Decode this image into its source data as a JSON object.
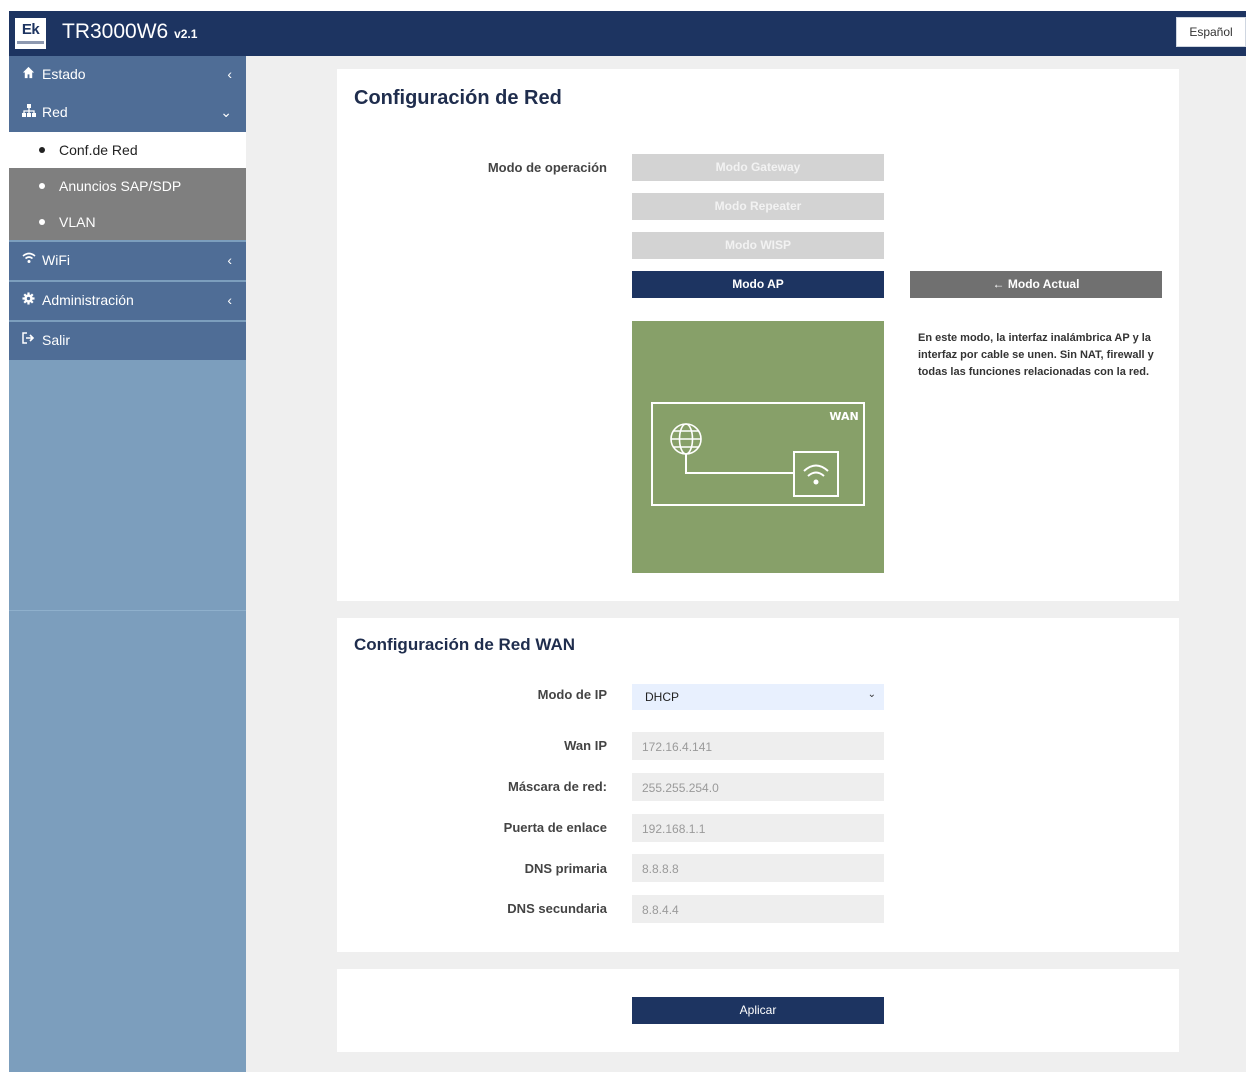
{
  "header": {
    "logo_text": "Ek",
    "title": "TR3000W6",
    "version": "v2.1",
    "language": "Español"
  },
  "sidebar": {
    "items": [
      {
        "icon": "home-icon",
        "label": "Estado",
        "chevron": "‹"
      },
      {
        "icon": "sitemap-icon",
        "label": "Red",
        "chevron": "⌄"
      },
      {
        "icon": "wifi-icon",
        "label": "WiFi",
        "chevron": "‹"
      },
      {
        "icon": "gear-icon",
        "label": "Administración",
        "chevron": "‹"
      },
      {
        "icon": "sign-out-icon",
        "label": "Salir"
      }
    ],
    "subitems": [
      {
        "label": "Conf.de Red",
        "active": true
      },
      {
        "label": "Anuncios SAP/SDP",
        "active": false
      },
      {
        "label": "VLAN",
        "active": false
      }
    ]
  },
  "network_config": {
    "title": "Configuración de Red",
    "operation_mode_label": "Modo de operación",
    "modes": [
      {
        "label": "Modo Gateway",
        "active": false
      },
      {
        "label": "Modo Repeater",
        "active": false
      },
      {
        "label": "Modo WISP",
        "active": false
      },
      {
        "label": "Modo AP",
        "active": true
      }
    ],
    "current_mode_label": "← Modo Actual",
    "diagram_wan_label": "WAN",
    "description": "En este modo, la interfaz inalámbrica AP y la interfaz por cable se unen. Sin NAT, firewall y todas las funciones relacionadas con la red."
  },
  "wan_config": {
    "title": "Configuración de Red WAN",
    "ip_mode": {
      "label": "Modo de IP",
      "value": "DHCP"
    },
    "fields": [
      {
        "label": "Wan IP",
        "value": "172.16.4.141"
      },
      {
        "label": "Máscara de red:",
        "value": "255.255.254.0"
      },
      {
        "label": "Puerta de enlace",
        "value": "192.168.1.1"
      },
      {
        "label": "DNS primaria",
        "value": "8.8.8.8"
      },
      {
        "label": "DNS secundaria",
        "value": "8.8.4.4"
      }
    ]
  },
  "actions": {
    "apply_label": "Aplicar"
  },
  "colors": {
    "header_bg": "#1d3461",
    "sidebar_bg": "#7c9ebd",
    "nav_item_bg": "#4f6d96",
    "submenu_bg": "#7f7f7f",
    "mode_inactive": "#d3d3d3",
    "diagram_bg": "#87a069",
    "current_mode_bg": "#707070"
  }
}
